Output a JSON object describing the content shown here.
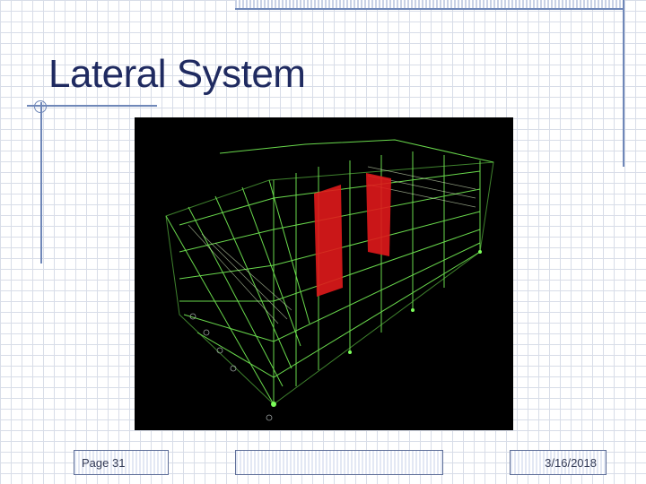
{
  "slide": {
    "title": "Lateral System",
    "footer_page": "Page 31",
    "footer_date": "3/16/2018"
  },
  "figure": {
    "description_icon": "structural-3d-frame-model",
    "background_color": "#000000",
    "frame_color": "#7cff5a",
    "shear_wall_color": "#e0191b"
  },
  "colors": {
    "title": "#1f2a60",
    "accent_lines": "#6f87b8",
    "grid": "#d8dde8"
  }
}
